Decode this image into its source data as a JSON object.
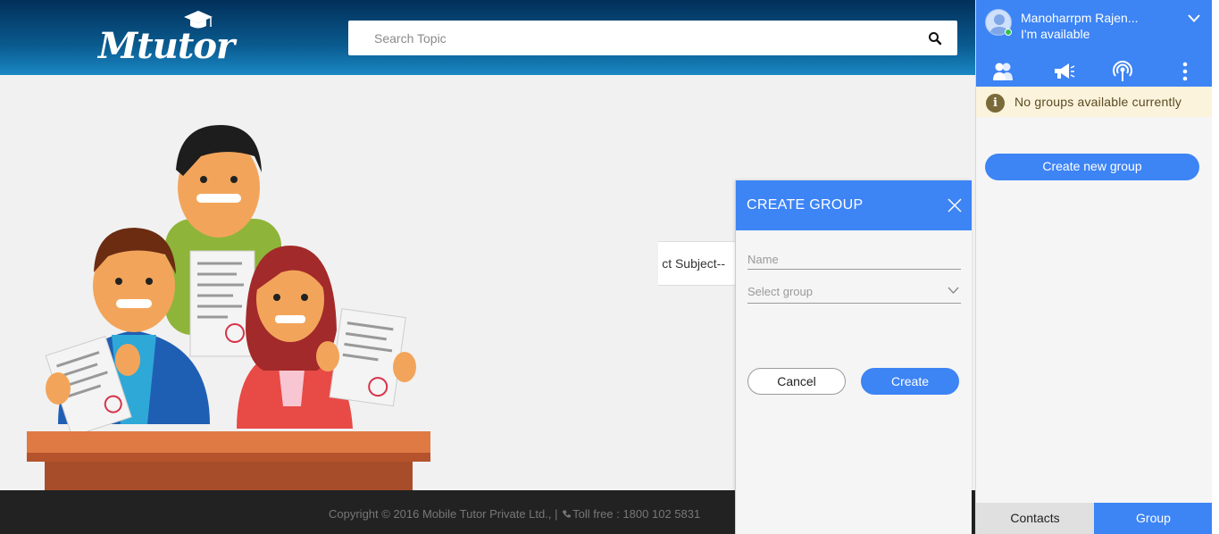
{
  "header": {
    "logo_text": "Mtutor",
    "search": {
      "placeholder": "Search Topic"
    }
  },
  "main": {
    "subject_select_value": "ct Subject--"
  },
  "footer": {
    "copyright": "Copyright © 2016 Mobile Tutor Private Ltd., | ",
    "toll_free": "Toll free : 1800 102 5831"
  },
  "dialog": {
    "title": "CREATE GROUP",
    "name_placeholder": "Name",
    "select_group_placeholder": "Select group",
    "cancel_label": "Cancel",
    "create_label": "Create"
  },
  "panel": {
    "user_name": "Manoharrpm Rajen...",
    "user_status": "I'm available",
    "notice": "No groups available currently",
    "create_new_group_label": "Create new group",
    "tabs": [
      {
        "label": "Contacts",
        "active": false
      },
      {
        "label": "Group",
        "active": true
      }
    ],
    "icons": [
      "contacts-icon",
      "megaphone-icon",
      "broadcast-icon",
      "more-vertical-icon"
    ]
  },
  "colors": {
    "accent": "#3d84f5",
    "header_dark": "#02305a",
    "footer": "#222222",
    "notice_bg": "#fbf3dc",
    "online": "#2fc34d"
  }
}
